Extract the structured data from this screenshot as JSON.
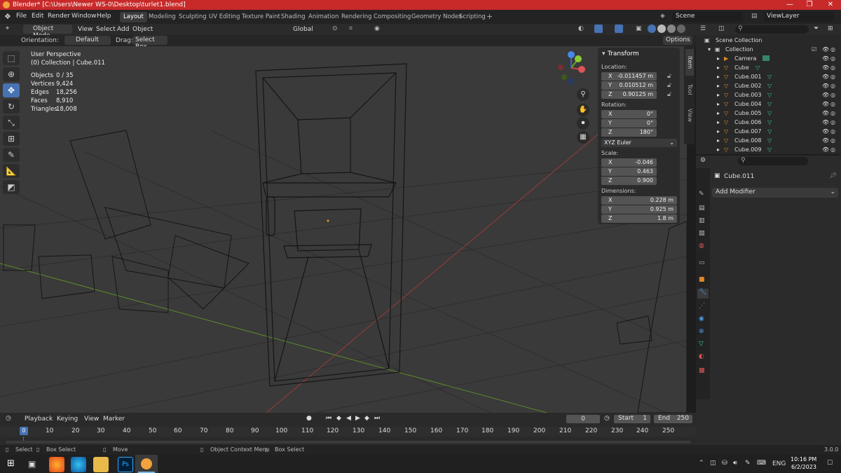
{
  "window": {
    "title": "Blender* [C:\\Users\\Newer WS-0\\Desktop\\turlet1.blend]",
    "controls": [
      "—",
      "❐",
      "✕"
    ]
  },
  "menu": [
    "File",
    "Edit",
    "Render",
    "Window",
    "Help"
  ],
  "workspaces": [
    "Layout",
    "Modeling",
    "Sculpting",
    "UV Editing",
    "Texture Paint",
    "Shading",
    "Animation",
    "Rendering",
    "Compositing",
    "Geometry Nodes",
    "Scripting"
  ],
  "scene": {
    "name": "Scene",
    "view_layer": "ViewLayer"
  },
  "viewport_header": {
    "mode": "Object Mode",
    "menus": [
      "View",
      "Select",
      "Add",
      "Object"
    ],
    "transform": "Global"
  },
  "tool_settings": {
    "orientation_label": "Orientation:",
    "orientation": "Default",
    "drag_label": "Drag:",
    "drag": "Select Box",
    "options": "Options"
  },
  "viewport_info": {
    "view": "User Perspective",
    "collection": "(0) Collection | Cube.011",
    "stats": [
      [
        "Objects",
        "0 / 35"
      ],
      [
        "Vertices",
        "9,424"
      ],
      [
        "Edges",
        "18,256"
      ],
      [
        "Faces",
        "8,910"
      ],
      [
        "Triangles",
        "18,008"
      ]
    ]
  },
  "n_panel": {
    "header": "Transform",
    "location_label": "Location:",
    "location": [
      [
        "X",
        "-0.011457 m"
      ],
      [
        "Y",
        "0.010512 m"
      ],
      [
        "Z",
        "0.90125 m"
      ]
    ],
    "rotation_label": "Rotation:",
    "rotation": [
      [
        "X",
        "0°"
      ],
      [
        "Y",
        "0°"
      ],
      [
        "Z",
        "180°"
      ]
    ],
    "rotation_mode": "XYZ Euler",
    "scale_label": "Scale:",
    "scale": [
      [
        "X",
        "-0.046"
      ],
      [
        "Y",
        "0.463"
      ],
      [
        "Z",
        "0.900"
      ]
    ],
    "dimensions_label": "Dimensions:",
    "dimensions": [
      [
        "X",
        "0.228 m"
      ],
      [
        "Y",
        "0.925 m"
      ],
      [
        "Z",
        "1.8 m"
      ]
    ],
    "tabs": [
      "Item",
      "Tool",
      "View"
    ]
  },
  "outliner": {
    "root": "Scene Collection",
    "collection": "Collection",
    "items": [
      "Camera",
      "Cube",
      "Cube.001",
      "Cube.002",
      "Cube.003",
      "Cube.004",
      "Cube.005",
      "Cube.006",
      "Cube.007",
      "Cube.008",
      "Cube.009"
    ]
  },
  "properties": {
    "object": "Cube.011",
    "add_modifier": "Add Modifier"
  },
  "timeline": {
    "menus": [
      "Playback",
      "Keying",
      "View",
      "Marker"
    ],
    "current_frame": "0",
    "start_label": "Start",
    "start": "1",
    "end_label": "End",
    "end": "250",
    "ticks": [
      "0",
      "10",
      "20",
      "30",
      "40",
      "50",
      "60",
      "70",
      "80",
      "90",
      "100",
      "110",
      "120",
      "130",
      "140",
      "150",
      "160",
      "170",
      "180",
      "190",
      "200",
      "210",
      "220",
      "230",
      "240",
      "250"
    ]
  },
  "statusbar": {
    "items": [
      "Select",
      "Box Select",
      "Move",
      "Object Context Menu",
      "Box Select"
    ],
    "version": "3.0.0"
  },
  "taskbar": {
    "lang": "ENG",
    "time": "10:16 PM",
    "date": "6/2/2023"
  },
  "colors": {
    "accent": "#4772b3",
    "title_bar": "#c82a2a",
    "object_orange": "#e0872b",
    "mesh_green": "#3fc48f"
  }
}
